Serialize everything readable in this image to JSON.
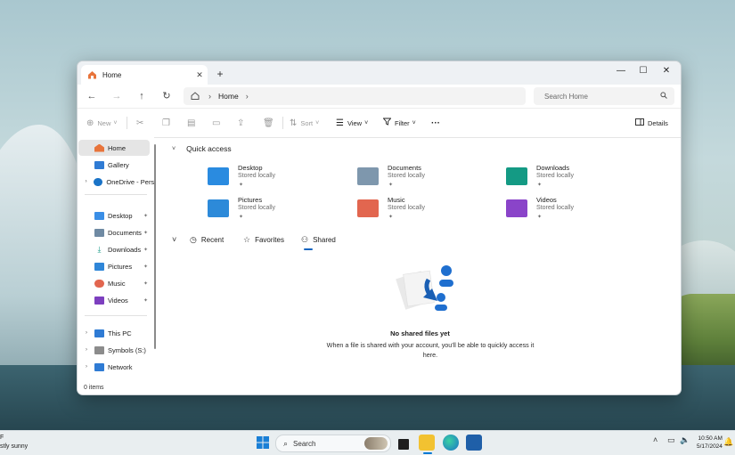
{
  "window": {
    "tab_label": "Home",
    "tab_close": "✕",
    "new_tab": "+",
    "minimize": "—",
    "maximize": "☐",
    "close": "✕"
  },
  "address": {
    "nav": [
      "←",
      "→",
      "↑",
      "↻"
    ],
    "crumb": "Home",
    "search_placeholder": "Search Home"
  },
  "toolbar": {
    "new_label": "New",
    "sort_label": "Sort",
    "view_label": "View",
    "filter_label": "Filter",
    "more_label": "···",
    "details_label": "Details"
  },
  "sidebar": {
    "items": [
      {
        "label": "Home",
        "icon": "home-icon",
        "color": "#e8743b",
        "selected": true
      },
      {
        "label": "Gallery",
        "icon": "gallery-icon",
        "color": "#2f7bd4"
      },
      {
        "label": "OneDrive - Perso",
        "icon": "cloud-icon",
        "color": "#1a73c7",
        "expand": true
      }
    ],
    "pinned": [
      {
        "label": "Desktop",
        "icon": "desktop-icon",
        "color": "#3a8ee6"
      },
      {
        "label": "Documents",
        "icon": "documents-icon",
        "color": "#6f8aa3"
      },
      {
        "label": "Downloads",
        "icon": "downloads-icon",
        "color": "#1c9c8a"
      },
      {
        "label": "Pictures",
        "icon": "pictures-icon",
        "color": "#2f86d8"
      },
      {
        "label": "Music",
        "icon": "music-icon",
        "color": "#e2664f"
      },
      {
        "label": "Videos",
        "icon": "videos-icon",
        "color": "#7d3fbf"
      }
    ],
    "drives": [
      {
        "label": "This PC",
        "icon": "pc-icon",
        "color": "#2f7bd4"
      },
      {
        "label": "Symbols (S:)",
        "icon": "drive-icon",
        "color": "#8c8c8c"
      },
      {
        "label": "Network",
        "icon": "network-icon",
        "color": "#2f7bd4"
      }
    ],
    "pin_glyph": "📌",
    "status": "0 items"
  },
  "quick_access": {
    "title": "Quick access",
    "items": [
      {
        "name": "Desktop",
        "sub": "Stored locally",
        "color": "#2a8be0",
        "icon": "desktop-folder-icon"
      },
      {
        "name": "Documents",
        "sub": "Stored locally",
        "color": "#7e97ad",
        "icon": "documents-folder-icon"
      },
      {
        "name": "Downloads",
        "sub": "Stored locally",
        "color": "#149a84",
        "icon": "downloads-folder-icon"
      },
      {
        "name": "Pictures",
        "sub": "Stored locally",
        "color": "#2d8ad9",
        "icon": "pictures-folder-icon"
      },
      {
        "name": "Music",
        "sub": "Stored locally",
        "color": "#e2664f",
        "icon": "music-folder-icon"
      },
      {
        "name": "Videos",
        "sub": "Stored locally",
        "color": "#8a44c9",
        "icon": "videos-folder-icon"
      }
    ]
  },
  "lower_tabs": {
    "recent": "Recent",
    "favorites": "Favorites",
    "shared": "Shared"
  },
  "empty_state": {
    "title": "No shared files yet",
    "description": "When a file is shared with your account, you'll be able to quickly access it here."
  },
  "taskbar": {
    "weather_line1": "F",
    "weather_line2": "stly sunny",
    "search_label": "Search",
    "time": "10:50 AM",
    "date": "5/17/2024",
    "accent": "#0078d4"
  }
}
